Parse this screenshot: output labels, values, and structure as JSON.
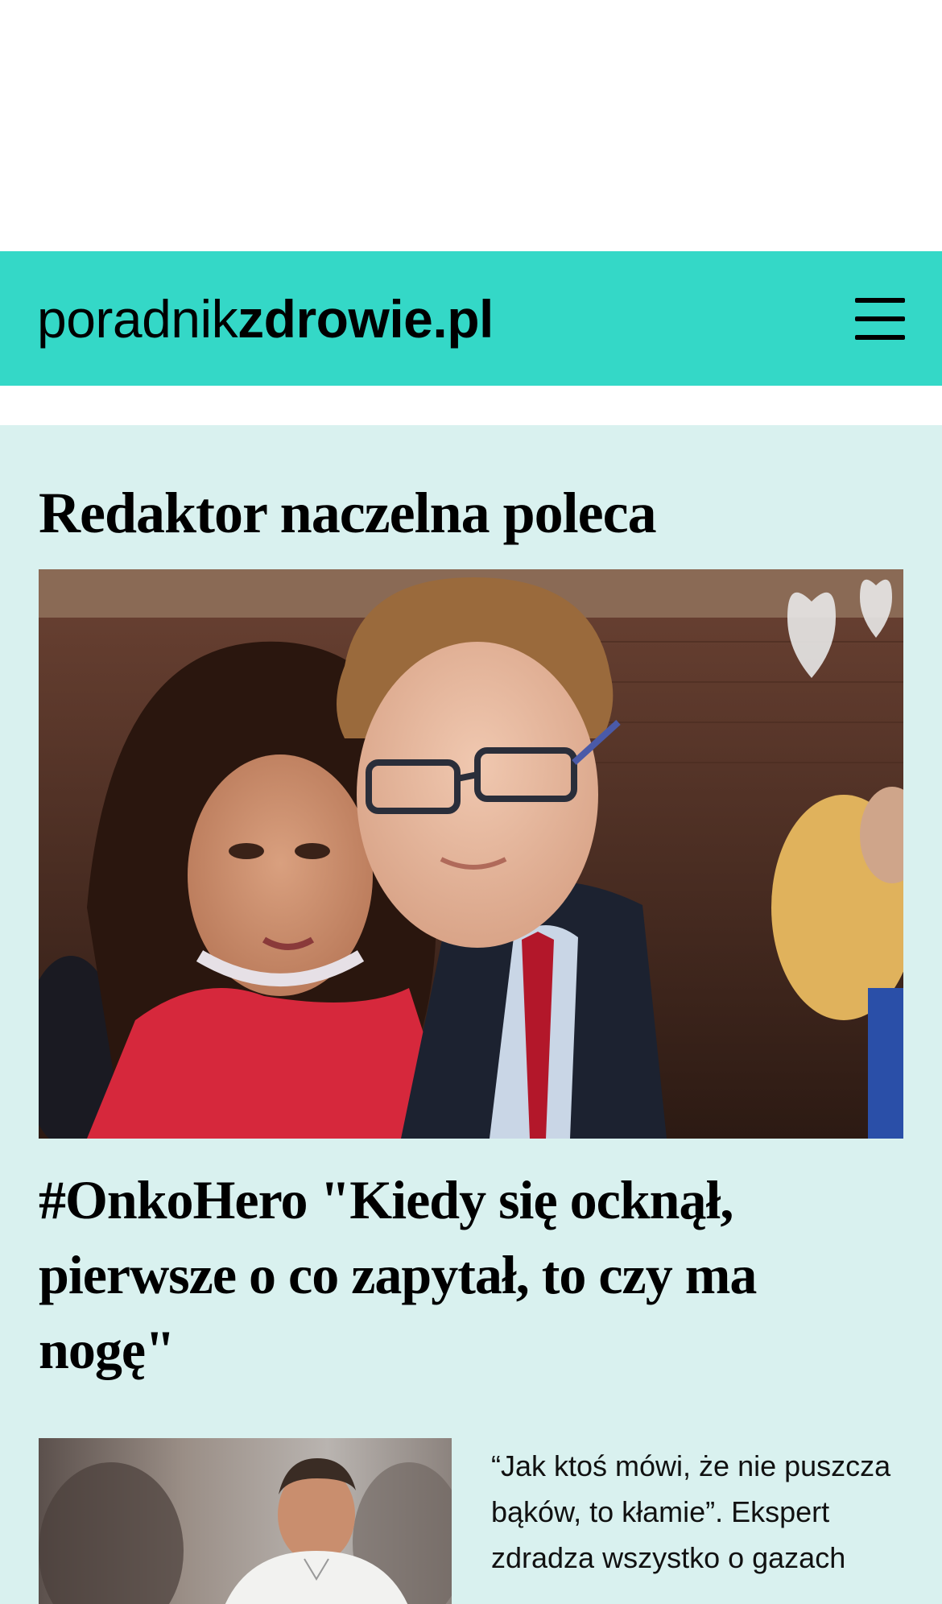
{
  "header": {
    "logo_light": "poradnik",
    "logo_bold": "zdrowie.pl",
    "menu_icon": "hamburger-menu-icon",
    "background_color": "#34d8c7"
  },
  "section": {
    "title": "Redaktor naczelna poleca",
    "background_color": "#d9f1ef"
  },
  "featured": {
    "title": "#OnkoHero \"Kiedy się ocknął, pierwsze o co zapytał, to czy ma nogę\""
  },
  "cards": [
    {
      "title": "“Jak ktoś mówi, że nie puszcza bąków, to kłamie”. Ekspert zdradza wszystko o gazach"
    }
  ]
}
